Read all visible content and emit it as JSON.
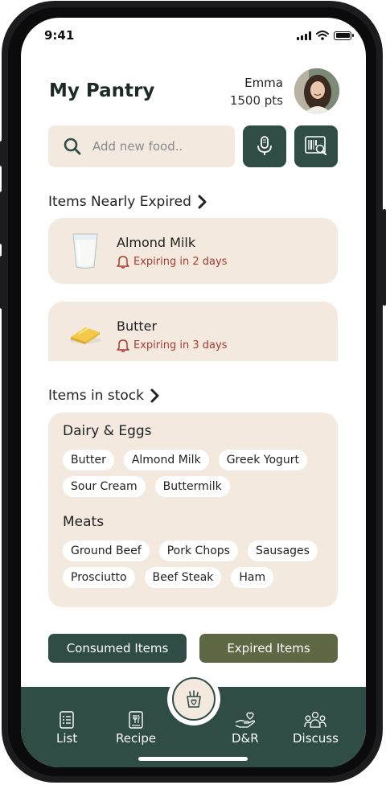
{
  "status_bar": {
    "time": "9:41"
  },
  "header": {
    "title": "My Pantry",
    "user_name": "Emma",
    "points": "1500 pts"
  },
  "search": {
    "placeholder": "Add new food.."
  },
  "nearly_expired": {
    "title": "Items Nearly Expired",
    "items": [
      {
        "name": "Almond Milk",
        "status": "Expiring in 2 days"
      },
      {
        "name": "Butter",
        "status": "Expiring in 3 days"
      }
    ]
  },
  "in_stock": {
    "title": "Items in stock",
    "categories": [
      {
        "name": "Dairy & Eggs",
        "rows": [
          [
            "Butter",
            "Almond Milk",
            "Greek Yogurt"
          ],
          [
            "Sour Cream",
            "Buttermilk"
          ]
        ]
      },
      {
        "name": "Meats",
        "rows": [
          [
            "Ground Beef",
            "Pork Chops",
            "Sausages"
          ],
          [
            "Prosciutto",
            "Beef Steak",
            "Ham"
          ]
        ]
      }
    ]
  },
  "actions": {
    "consumed": "Consumed Items",
    "expired": "Expired Items"
  },
  "nav": {
    "list": "List",
    "recipe": "Recipe",
    "dr": "D&R",
    "discuss": "Discuss"
  },
  "colors": {
    "primary": "#2f4c45",
    "secondary": "#5f6845",
    "card": "#f3e9df",
    "alert": "#a93a30"
  },
  "icons": [
    "search-icon",
    "microphone-icon",
    "barcode-scan-icon",
    "chevron-right-icon",
    "bell-icon",
    "list-icon",
    "recipe-icon",
    "pantry-icon",
    "donate-icon",
    "discuss-icon"
  ]
}
